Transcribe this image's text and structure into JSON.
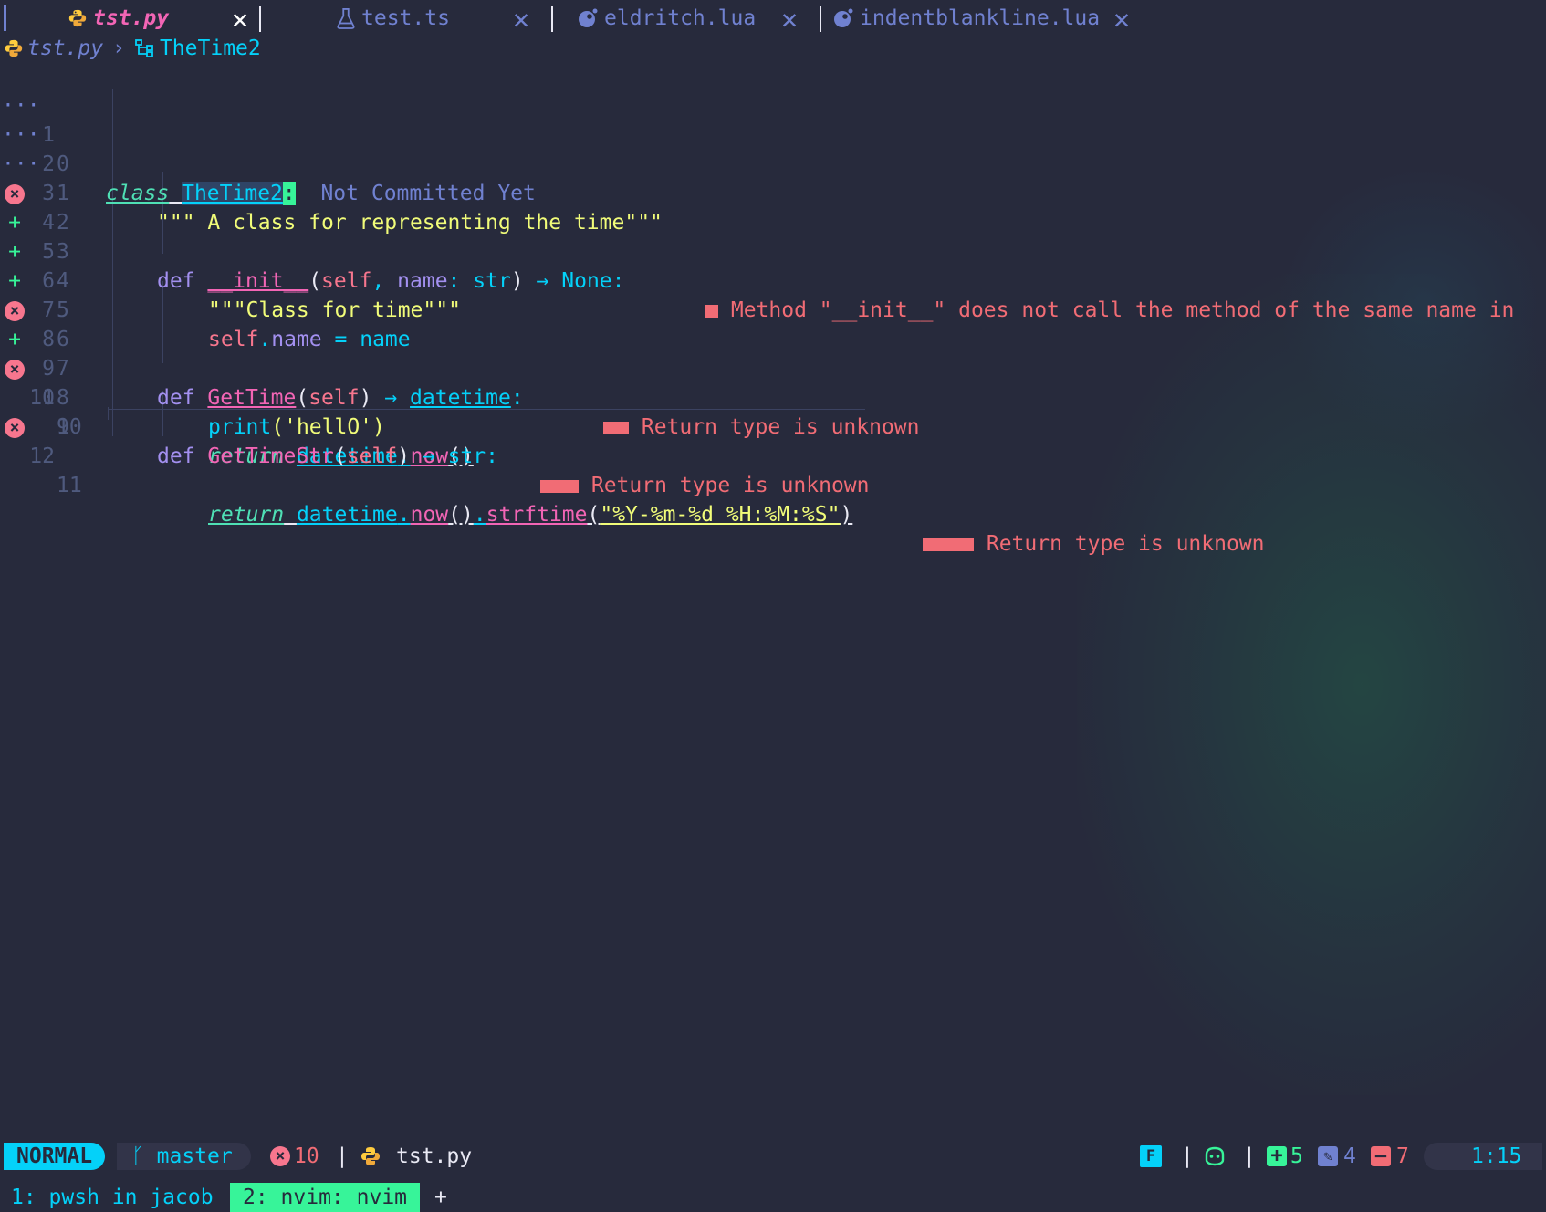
{
  "tabs": [
    {
      "label": "tst.py",
      "icon": "python-icon",
      "active": true
    },
    {
      "label": "test.ts",
      "icon": "flask-icon",
      "active": false
    },
    {
      "label": "eldritch.lua",
      "icon": "lua-icon",
      "active": false
    },
    {
      "label": "indentblankline.lua",
      "icon": "lua-icon",
      "active": false
    }
  ],
  "winbar": {
    "file": "tst.py",
    "sep": "›",
    "symbol": "TheTime2"
  },
  "lines": [
    {
      "rel": "1",
      "abs": "0"
    },
    {
      "rel": "2",
      "abs": "1"
    },
    {
      "rel": "3",
      "abs": "2"
    },
    {
      "rel": "4",
      "abs": "3"
    },
    {
      "rel": "5",
      "abs": "4"
    },
    {
      "rel": "6",
      "abs": "5"
    },
    {
      "rel": "7",
      "abs": "6"
    },
    {
      "rel": "8",
      "abs": "7"
    },
    {
      "rel": "9",
      "abs": "8"
    },
    {
      "rel": "10",
      "abs": "9"
    },
    {
      "rel": "11",
      "abs": "10"
    },
    {
      "rel": "12",
      "abs": "11"
    }
  ],
  "code": {
    "l0": {
      "kw": "class",
      "name": "TheTime2",
      "colon": ":",
      "blame": "Not Committed Yet"
    },
    "l1": {
      "doc": "\"\"\" A class for representing the time\"\"\""
    },
    "l3": {
      "kw": "def",
      "fn": "__init__",
      "open": "(",
      "self": "self",
      "comma": ",",
      "param": "name",
      "colon": ":",
      "type": "str",
      "close": ")",
      "arrow": "→",
      "ret": "None",
      "end": ":",
      "diag": "Method \"__init__\" does not call the method of the same name in"
    },
    "l4": {
      "doc": "\"\"\"Class for time\"\"\""
    },
    "l5": {
      "self": "self",
      "dot": ".",
      "attr": "name",
      "eq": "=",
      "val": "name"
    },
    "l7": {
      "kw": "def",
      "fn": "GetTime",
      "open": "(",
      "self": "self",
      "close": ")",
      "arrow": "→",
      "ret": "datetime",
      "end": ":",
      "diag": "Return type is unknown"
    },
    "l8": {
      "fn": "print",
      "args": "('hellO')"
    },
    "l9": {
      "kw": "return",
      "obj": "datetime",
      "dot": ".",
      "call": "now",
      "paren": "()",
      "diag": "Return type is unknown"
    },
    "l10": {
      "kw": "def",
      "fn": "GetTimeStr",
      "open": "(",
      "self": "self",
      "close": ")",
      "arrow": "→",
      "ret": "str",
      "end": ":"
    },
    "l11": {
      "kw": "return",
      "obj": "datetime",
      "dot": ".",
      "call": "now",
      "paren": "()",
      "dot2": ".",
      "call2": "strftime",
      "open": "(",
      "fmt": "\"%Y-%m-%d %H:%M:%S\"",
      "close": ")",
      "diag": "Return type is unknown"
    }
  },
  "status": {
    "mode": "NORMAL",
    "branch": "master",
    "errors": "10",
    "sep": "|",
    "filename": "tst.py",
    "fmt_badge": "F",
    "added": "5",
    "changed": "4",
    "removed": "7",
    "position": "1:15"
  },
  "tmux": {
    "win1": "1: pwsh in jacob",
    "win2": "2: nvim: nvim",
    "new": "+"
  },
  "colors": {
    "accent": "#04d1f9",
    "green": "#37f499",
    "error": "#f16c75",
    "bg": "#272a3c",
    "purple": "#a390f0",
    "pink": "#f265b5",
    "yellow": "#f1fc79"
  }
}
